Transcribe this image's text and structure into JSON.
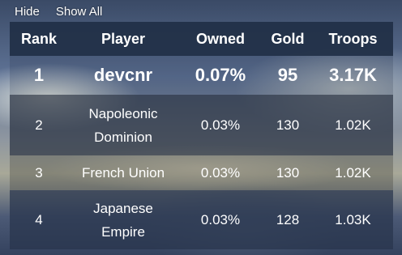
{
  "controls": {
    "hide_label": "Hide",
    "show_all_label": "Show All"
  },
  "columns": {
    "rank": "Rank",
    "player": "Player",
    "owned": "Owned",
    "gold": "Gold",
    "troops": "Troops"
  },
  "rows": [
    {
      "rank": "1",
      "player": "devcnr",
      "owned": "0.07%",
      "gold": "95",
      "troops": "3.17K"
    },
    {
      "rank": "2",
      "player_line1": "Napoleonic",
      "player_line2": "Dominion",
      "owned": "0.03%",
      "gold": "130",
      "troops": "1.02K"
    },
    {
      "rank": "3",
      "player": "French Union",
      "owned": "0.03%",
      "gold": "130",
      "troops": "1.02K"
    },
    {
      "rank": "4",
      "player_line1": "Japanese",
      "player_line2": "Empire",
      "owned": "0.03%",
      "gold": "128",
      "troops": "1.03K"
    }
  ]
}
